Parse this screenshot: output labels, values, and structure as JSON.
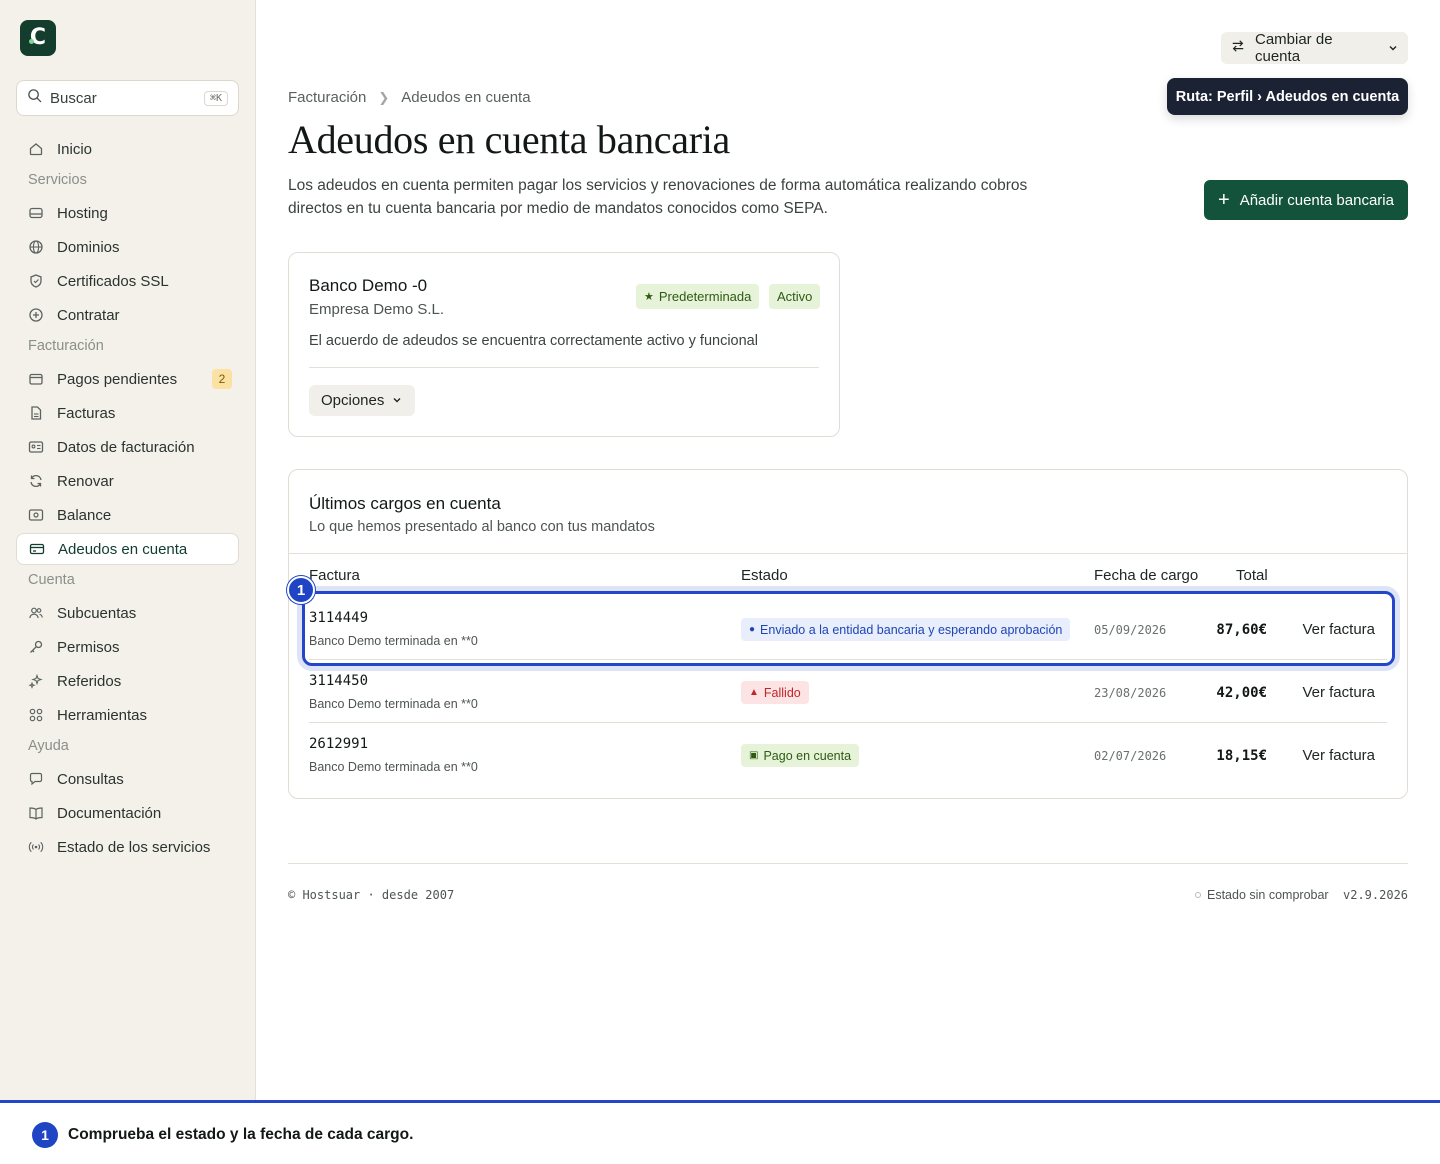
{
  "sidebar": {
    "logo_letter": "C",
    "search": {
      "placeholder": "Buscar",
      "shortcut": "⌘K"
    },
    "inicio": "Inicio",
    "sections": {
      "servicios": "Servicios",
      "facturacion": "Facturación",
      "cuenta": "Cuenta",
      "ayuda": "Ayuda"
    },
    "items": {
      "hosting": "Hosting",
      "dominios": "Dominios",
      "ssl": "Certificados SSL",
      "contratar": "Contratar",
      "pagos": "Pagos pendientes",
      "pagos_badge": "2",
      "facturas": "Facturas",
      "datos": "Datos de facturación",
      "renovar": "Renovar",
      "balance": "Balance",
      "adeudos": "Adeudos en cuenta",
      "subcuentas": "Subcuentas",
      "permisos": "Permisos",
      "referidos": "Referidos",
      "herramientas": "Herramientas",
      "consultas": "Consultas",
      "documentacion": "Documentación",
      "estado": "Estado de los servicios"
    }
  },
  "header": {
    "switch_account": "Cambiar de cuenta",
    "tooltip": "Ruta: Perfil › Adeudos en cuenta"
  },
  "breadcrumb": {
    "parent": "Facturación",
    "current": "Adeudos en cuenta"
  },
  "page": {
    "title": "Adeudos en cuenta bancaria",
    "description": "Los adeudos en cuenta permiten pagar los servicios y renovaciones de forma automática realizando cobros directos en tu cuenta bancaria por medio de mandatos conocidos como SEPA.",
    "add_button": "Añadir cuenta bancaria"
  },
  "bank_card": {
    "name": "Banco Demo ‑0",
    "company": "Empresa Demo S.L.",
    "tag_default": "Predeterminada",
    "tag_active": "Activo",
    "status_text": "El acuerdo de adeudos se encuentra correctamente activo y funcional",
    "options_button": "Opciones"
  },
  "charges": {
    "title": "Últimos cargos en cuenta",
    "subtitle": "Lo que hemos presentado al banco con tus mandatos",
    "columns": {
      "invoice": "Factura",
      "status": "Estado",
      "date": "Fecha de cargo",
      "total": "Total"
    },
    "rows": [
      {
        "invoice": "3114449",
        "bank": "Banco Demo terminada en **0",
        "status": "Enviado a la entidad bancaria y esperando aprobación",
        "status_color": "#1f45b5",
        "date": "05/09/2026",
        "total": "87,60€",
        "action": "Ver factura"
      },
      {
        "invoice": "3114450",
        "bank": "Banco Demo terminada en **0",
        "status": "Fallido",
        "status_color": "#c0262b",
        "date": "23/08/2026",
        "total": "42,00€",
        "action": "Ver factura"
      },
      {
        "invoice": "2612991",
        "bank": "Banco Demo terminada en **0",
        "status": "Pago en cuenta",
        "status_color": "#2e5a13",
        "date": "02/07/2026",
        "total": "18,15€",
        "action": "Ver factura"
      }
    ]
  },
  "highlight": {
    "marker": "1"
  },
  "footer": {
    "copyright": "© Hostsuar · desde 2007",
    "status": "Estado sin comprobar",
    "version": "v2.9.2026"
  },
  "tip": {
    "number": "1",
    "text": "Comprueba el estado y la fecha de cada cargo."
  },
  "colors": {
    "brand": "#13533b",
    "accent": "#2347c8",
    "tooltip_bg": "#1b2233"
  }
}
